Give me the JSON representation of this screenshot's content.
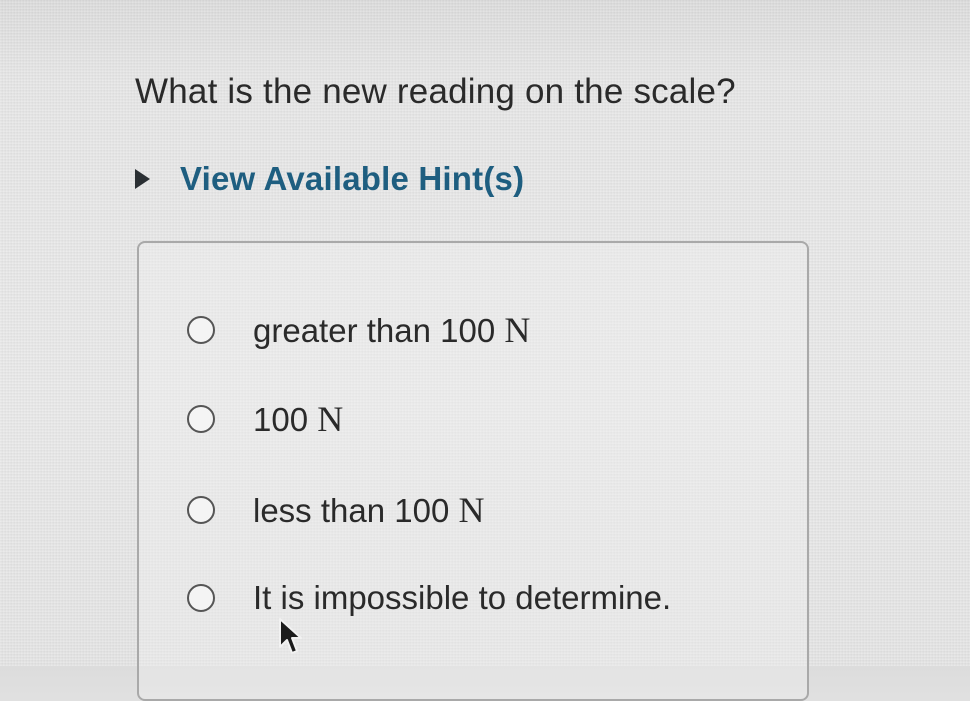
{
  "question": {
    "text": "What is the new reading on the scale?"
  },
  "hints": {
    "label": "View Available Hint(s)",
    "icon": "triangle-right-icon"
  },
  "options": [
    {
      "text": "greater than 100 ",
      "unit": "N",
      "selected": false
    },
    {
      "text": "100 ",
      "unit": "N",
      "selected": false
    },
    {
      "text": "less than 100 ",
      "unit": "N",
      "selected": false
    },
    {
      "text": "It is impossible to determine.",
      "unit": "",
      "selected": false
    }
  ],
  "cursor": {
    "icon": "mouse-pointer-icon"
  },
  "colors": {
    "hint_text": "#1e5e80",
    "question_text": "#2a2a2a",
    "border": "#a9a9a9"
  }
}
